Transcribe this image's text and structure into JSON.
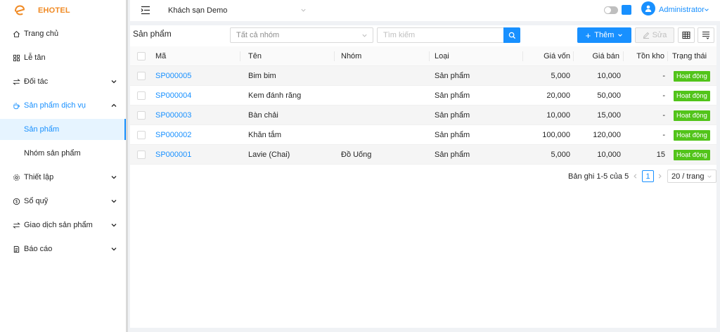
{
  "brand": {
    "name": "EHOTEL",
    "color": "#f08a24"
  },
  "sidebar": {
    "items": [
      {
        "label": "Trang chủ",
        "icon": "home-icon"
      },
      {
        "label": "Lễ tân",
        "icon": "grid-icon"
      },
      {
        "label": "Đối tác",
        "icon": "swap-icon",
        "expandable": true
      },
      {
        "label": "Sản phẩm dịch vụ",
        "icon": "coffee-icon",
        "expandable": true,
        "open": true
      },
      {
        "label": "Thiết lập",
        "icon": "gear-icon",
        "expandable": true
      },
      {
        "label": "Sổ quỹ",
        "icon": "dollar-icon",
        "expandable": true
      },
      {
        "label": "Giao dịch sản phẩm",
        "icon": "swap-icon",
        "expandable": true
      },
      {
        "label": "Báo cáo",
        "icon": "report-icon",
        "expandable": true
      }
    ],
    "subitems": [
      {
        "label": "Sản phẩm",
        "active": true
      },
      {
        "label": "Nhóm sản phẩm",
        "active": false
      }
    ]
  },
  "topbar": {
    "hotel": "Khách sạn Demo",
    "user": "Administrator"
  },
  "main": {
    "title": "Sản phẩm",
    "group_filter": "Tất cả nhóm",
    "search_placeholder": "Tìm kiếm",
    "add_label": "Thêm",
    "edit_label": "Sửa",
    "table": {
      "columns": [
        "Mã",
        "Tên",
        "Nhóm",
        "Loại",
        "Giá vốn",
        "Giá bán",
        "Tồn kho",
        "Trạng thái"
      ],
      "rows": [
        {
          "code": "SP000005",
          "name": "Bim bim",
          "group": "",
          "type": "Sản phẩm",
          "cost": "5,000",
          "price": "10,000",
          "stock": "-",
          "status": "Hoạt động"
        },
        {
          "code": "SP000004",
          "name": "Kem đánh răng",
          "group": "",
          "type": "Sản phẩm",
          "cost": "20,000",
          "price": "50,000",
          "stock": "-",
          "status": "Hoạt động"
        },
        {
          "code": "SP000003",
          "name": "Bàn chải",
          "group": "",
          "type": "Sản phẩm",
          "cost": "10,000",
          "price": "15,000",
          "stock": "-",
          "status": "Hoạt động"
        },
        {
          "code": "SP000002",
          "name": "Khăn tắm",
          "group": "",
          "type": "Sản phẩm",
          "cost": "100,000",
          "price": "120,000",
          "stock": "-",
          "status": "Hoạt động"
        },
        {
          "code": "SP000001",
          "name": "Lavie (Chai)",
          "group": "Đồ Uống",
          "type": "Sản phẩm",
          "cost": "5,000",
          "price": "10,000",
          "stock": "15",
          "status": "Hoạt động"
        }
      ]
    },
    "pagination": {
      "summary": "Bản ghi 1-5 của 5",
      "current_page": "1",
      "page_size": "20 / trang"
    }
  },
  "colors": {
    "primary": "#1890ff",
    "success": "#52c41a"
  }
}
